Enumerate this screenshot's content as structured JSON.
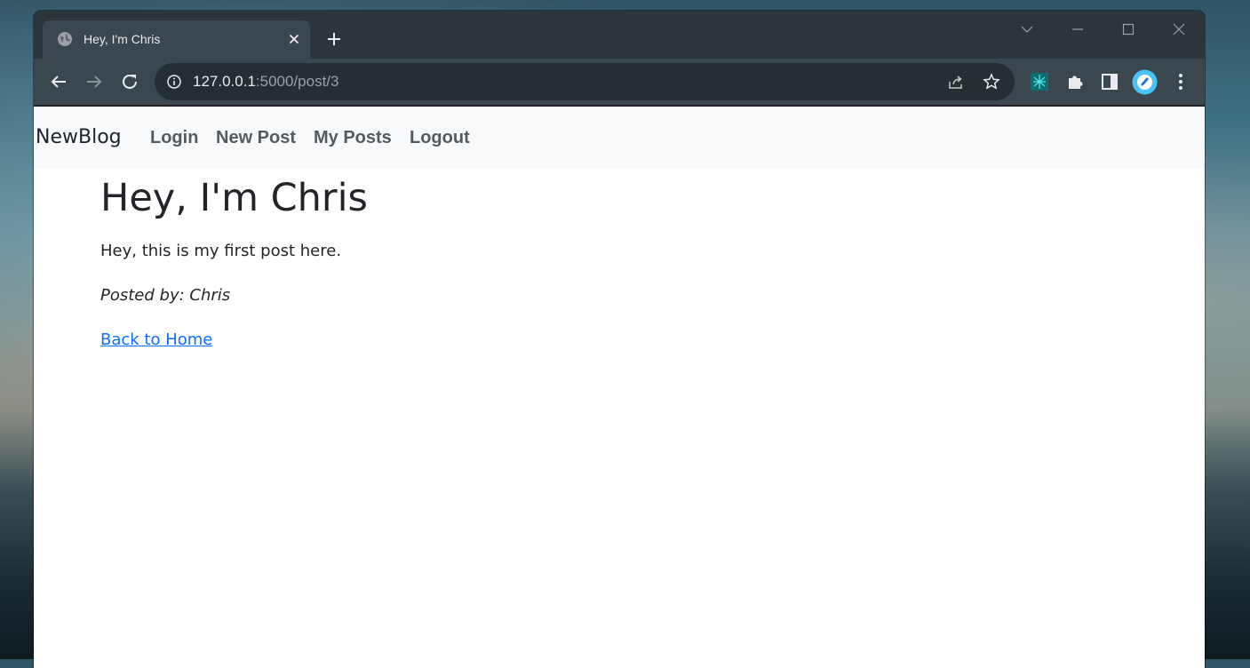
{
  "browser": {
    "tab": {
      "title": "Hey, I'm Chris",
      "favicon": "globe-icon",
      "close_icon": "close-icon"
    },
    "new_tab_icon": "plus-icon",
    "window_controls": [
      "chevron-down-icon",
      "minimize-icon",
      "maximize-icon",
      "close-window-icon"
    ],
    "toolbar": {
      "back_icon": "back-arrow-icon",
      "forward_icon": "forward-arrow-icon",
      "reload_icon": "reload-icon",
      "url_host": "127.0.0.1",
      "url_rest": ":5000/post/3",
      "extensions": [
        "brain-extension-icon",
        "puzzle-icon",
        "sidepanel-icon",
        "profile-avatar",
        "kebab-menu-icon"
      ]
    }
  },
  "navbar": {
    "brand": "NewBlog",
    "links": [
      {
        "label": "Login"
      },
      {
        "label": "New Post"
      },
      {
        "label": "My Posts"
      },
      {
        "label": "Logout"
      }
    ]
  },
  "post": {
    "title": "Hey, I'm Chris",
    "body": "Hey, this is my first post here.",
    "author": "Posted by: Chris",
    "back_link": "Back to Home"
  },
  "colors": {
    "link": "#0d6efd",
    "navbar_bg": "#f8f9fa",
    "nav_link": "#555a5f",
    "browser_frame": "#2b353b",
    "toolbar": "#3b474e"
  }
}
